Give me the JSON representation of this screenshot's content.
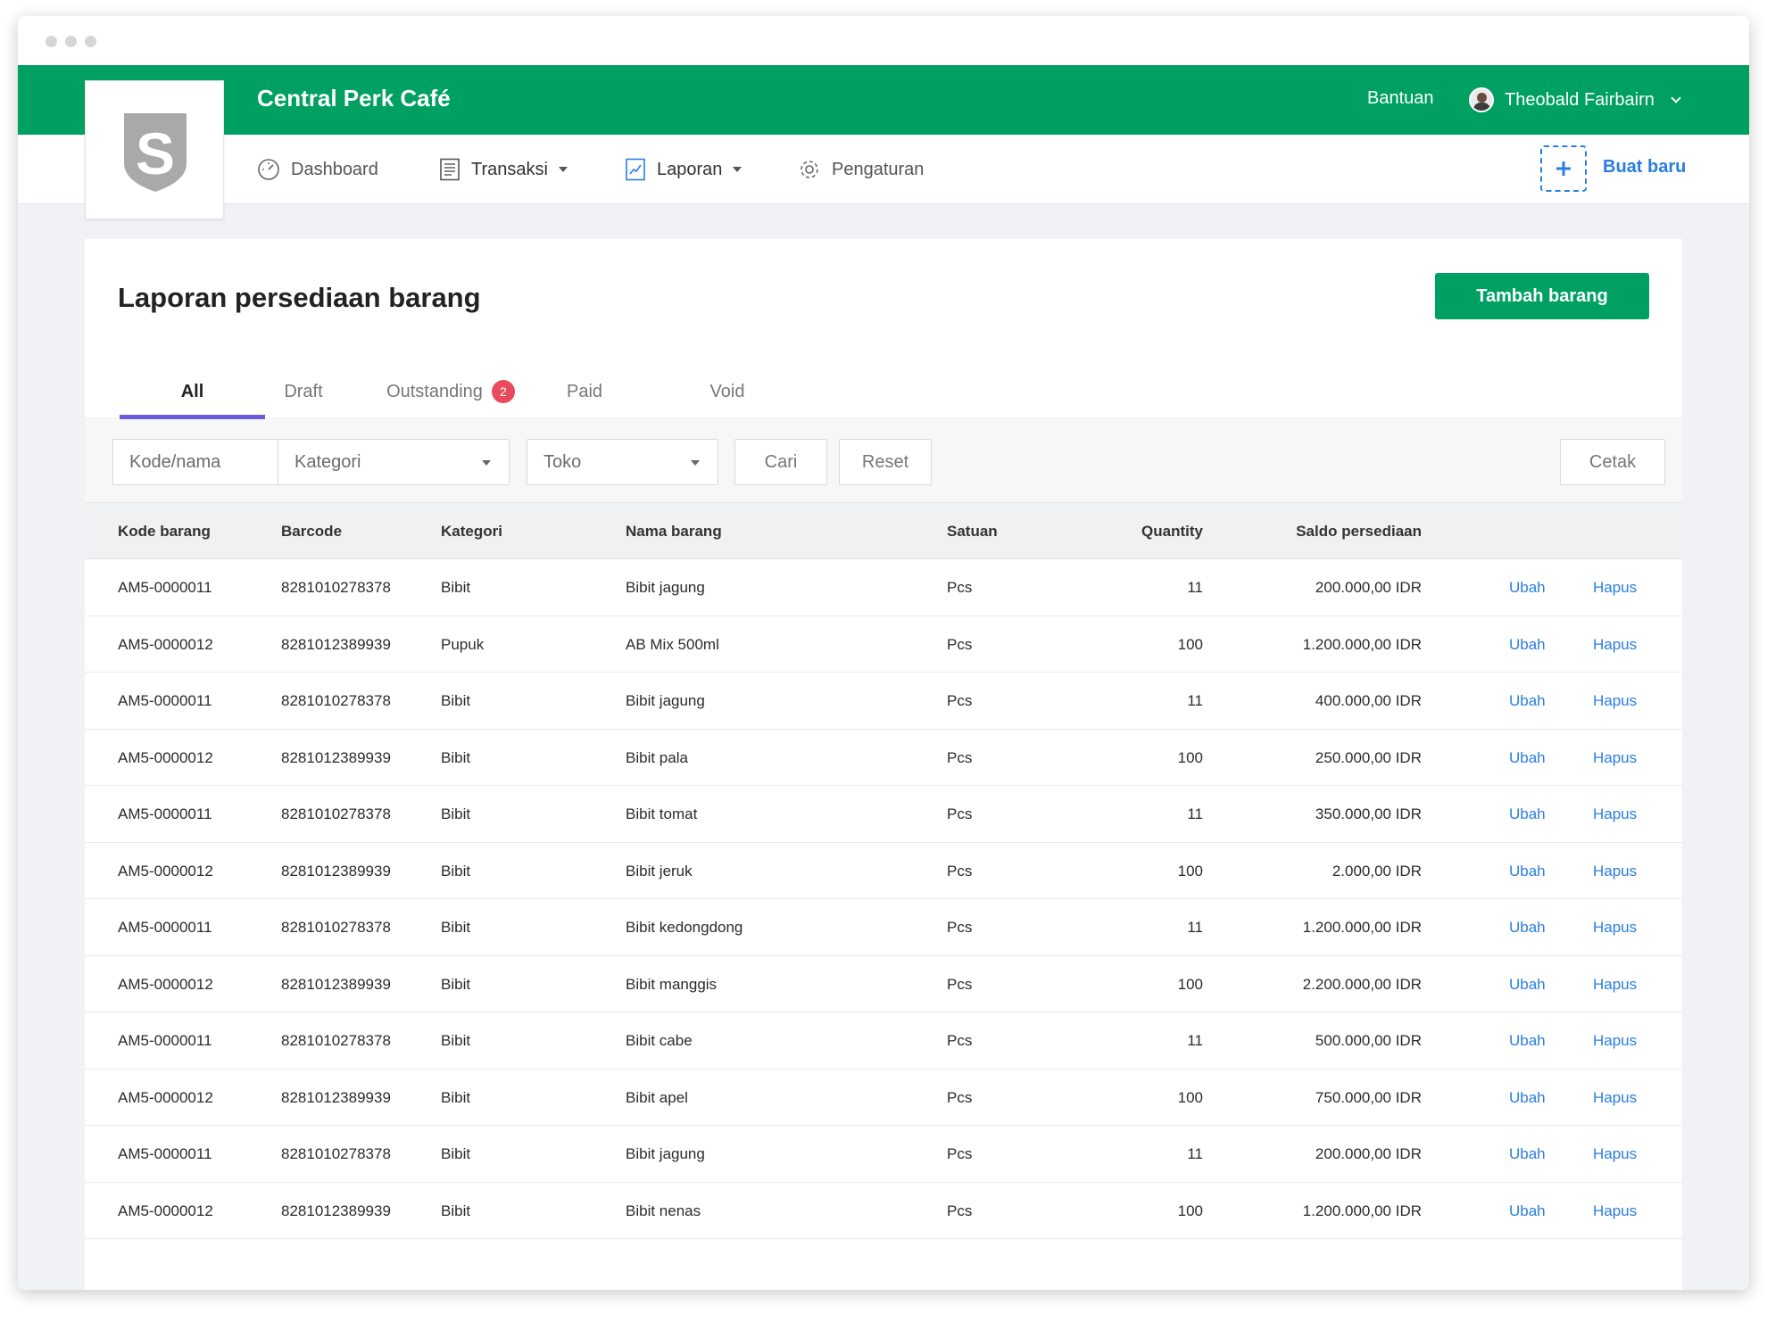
{
  "app": {
    "brand_name": "Central Perk Café",
    "help_label": "Bantuan",
    "user_name": "Theobald Fairbairn",
    "logo_letter": "S"
  },
  "nav": {
    "items": [
      {
        "label": "Dashboard",
        "icon": "speedometer-icon"
      },
      {
        "label": "Transaksi",
        "icon": "receipt-icon"
      },
      {
        "label": "Laporan",
        "icon": "report-chart-icon"
      },
      {
        "label": "Pengaturan",
        "icon": "gear-icon"
      }
    ],
    "create_label": "Buat baru"
  },
  "page": {
    "title": "Laporan persediaan barang",
    "add_button": "Tambah barang"
  },
  "tabs": [
    {
      "label": "All"
    },
    {
      "label": "Draft"
    },
    {
      "label": "Outstanding",
      "badge": "2"
    },
    {
      "label": "Paid"
    },
    {
      "label": "Void"
    }
  ],
  "filters": {
    "code_placeholder": "Kode/nama",
    "category_label": "Kategori",
    "store_label": "Toko",
    "search_button": "Cari",
    "reset_button": "Reset",
    "print_button": "Cetak"
  },
  "table": {
    "columns": [
      "Kode barang",
      "Barcode",
      "Kategori",
      "Nama barang",
      "Satuan",
      "Quantity",
      "Saldo persediaan"
    ],
    "edit_label": "Ubah",
    "delete_label": "Hapus",
    "rows": [
      {
        "code": "AM5-0000011",
        "barcode": "8281010278378",
        "category": "Bibit",
        "name": "Bibit jagung",
        "unit": "Pcs",
        "qty": "11",
        "balance": "200.000,00 IDR"
      },
      {
        "code": "AM5-0000012",
        "barcode": "8281012389939",
        "category": "Pupuk",
        "name": "AB Mix 500ml",
        "unit": "Pcs",
        "qty": "100",
        "balance": "1.200.000,00 IDR"
      },
      {
        "code": "AM5-0000011",
        "barcode": "8281010278378",
        "category": "Bibit",
        "name": "Bibit jagung",
        "unit": "Pcs",
        "qty": "11",
        "balance": "400.000,00 IDR"
      },
      {
        "code": "AM5-0000012",
        "barcode": "8281012389939",
        "category": "Bibit",
        "name": "Bibit pala",
        "unit": "Pcs",
        "qty": "100",
        "balance": "250.000,00 IDR"
      },
      {
        "code": "AM5-0000011",
        "barcode": "8281010278378",
        "category": "Bibit",
        "name": "Bibit tomat",
        "unit": "Pcs",
        "qty": "11",
        "balance": "350.000,00 IDR"
      },
      {
        "code": "AM5-0000012",
        "barcode": "8281012389939",
        "category": "Bibit",
        "name": "Bibit jeruk",
        "unit": "Pcs",
        "qty": "100",
        "balance": "2.000,00 IDR"
      },
      {
        "code": "AM5-0000011",
        "barcode": "8281010278378",
        "category": "Bibit",
        "name": "Bibit kedongdong",
        "unit": "Pcs",
        "qty": "11",
        "balance": "1.200.000,00 IDR"
      },
      {
        "code": "AM5-0000012",
        "barcode": "8281012389939",
        "category": "Bibit",
        "name": "Bibit manggis",
        "unit": "Pcs",
        "qty": "100",
        "balance": "2.200.000,00 IDR"
      },
      {
        "code": "AM5-0000011",
        "barcode": "8281010278378",
        "category": "Bibit",
        "name": "Bibit cabe",
        "unit": "Pcs",
        "qty": "11",
        "balance": "500.000,00 IDR"
      },
      {
        "code": "AM5-0000012",
        "barcode": "8281012389939",
        "category": "Bibit",
        "name": "Bibit apel",
        "unit": "Pcs",
        "qty": "100",
        "balance": "750.000,00 IDR"
      },
      {
        "code": "AM5-0000011",
        "barcode": "8281010278378",
        "category": "Bibit",
        "name": "Bibit jagung",
        "unit": "Pcs",
        "qty": "11",
        "balance": "200.000,00 IDR"
      },
      {
        "code": "AM5-0000012",
        "barcode": "8281012389939",
        "category": "Bibit",
        "name": "Bibit nenas",
        "unit": "Pcs",
        "qty": "100",
        "balance": "1.200.000,00 IDR"
      }
    ]
  },
  "colors": {
    "brand_green": "#00a063",
    "link_blue": "#2a7de1",
    "tab_accent": "#6a5ae0",
    "badge_red": "#e94b5d"
  }
}
